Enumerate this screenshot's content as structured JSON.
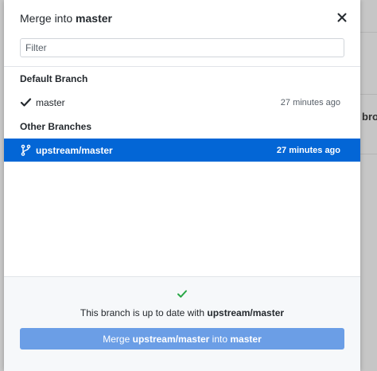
{
  "background_app": {
    "peek_text": "bro"
  },
  "dialog": {
    "title_prefix": "Merge into",
    "title_branch": "master",
    "filter": {
      "placeholder": "Filter",
      "value": ""
    },
    "sections": {
      "default": {
        "header": "Default Branch",
        "items": [
          {
            "name": "master",
            "time": "27 minutes ago",
            "icon": "check-icon",
            "selected": false
          }
        ]
      },
      "other": {
        "header": "Other Branches",
        "items": [
          {
            "name": "upstream/master",
            "time": "27 minutes ago",
            "icon": "git-branch-icon",
            "selected": true
          }
        ]
      }
    },
    "footer": {
      "status_prefix": "This branch is up to date with",
      "status_branch": "upstream/master",
      "merge_button": {
        "prefix": "Merge",
        "source": "upstream/master",
        "middle": "into",
        "target": "master"
      }
    }
  },
  "colors": {
    "accent_blue": "#0366d6",
    "button_blue_disabled": "#6b9ee6",
    "success_green": "#28a745"
  }
}
